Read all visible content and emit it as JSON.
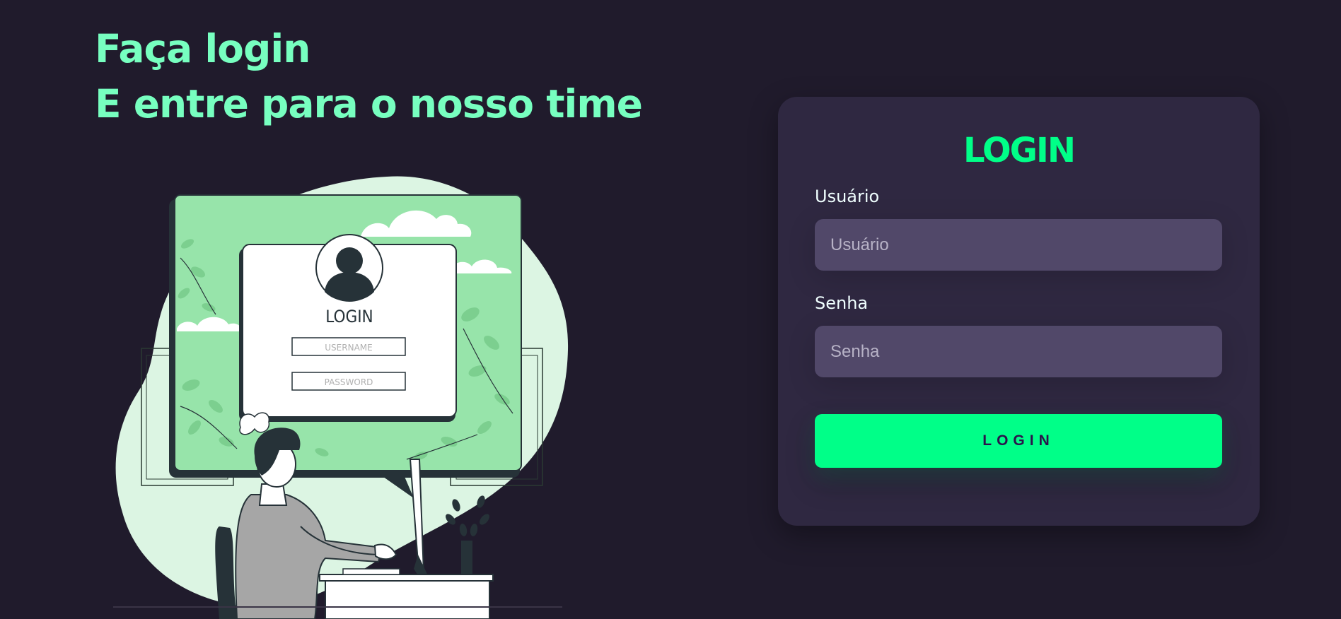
{
  "hero": {
    "line1": "Faça login",
    "line2": "E entre para o nosso time"
  },
  "illustration": {
    "login_title": "LOGIN",
    "username_placeholder": "USERNAME",
    "password_placeholder": "PASSWORD"
  },
  "form": {
    "title": "LOGIN",
    "username_label": "Usuário",
    "username_placeholder": "Usuário",
    "password_label": "Senha",
    "password_placeholder": "Senha",
    "submit_label": "LOGIN"
  },
  "colors": {
    "background": "#201b2c",
    "card": "#2f2841",
    "input": "#514869",
    "accent": "#00ff88",
    "headline": "#77ffc0"
  }
}
